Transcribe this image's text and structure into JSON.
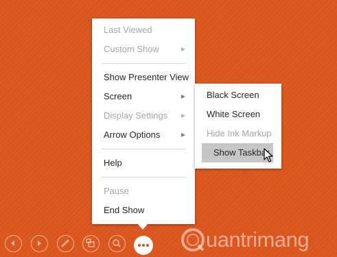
{
  "main_menu": {
    "last_viewed": "Last Viewed",
    "custom_show": "Custom Show",
    "show_presenter_view": "Show Presenter View",
    "screen": "Screen",
    "display_settings": "Display Settings",
    "arrow_options": "Arrow Options",
    "help": "Help",
    "pause": "Pause",
    "end_show": "End Show",
    "submenu_arrow": "▶"
  },
  "screen_submenu": {
    "black_screen": "Black Screen",
    "white_screen": "White Screen",
    "hide_ink_markup": "Hide Ink Markup",
    "show_taskbar": "Show Taskbar"
  },
  "toolbar": {
    "icons": [
      "previous-icon",
      "next-icon",
      "pen-icon",
      "slides-icon",
      "zoom-icon",
      "more-options-icon"
    ]
  },
  "watermark": {
    "text": "uantrimang",
    "logo": "Q"
  },
  "colors": {
    "background": "#d9551c",
    "menu_bg": "#ffffff",
    "selected_bg": "#c6c6c6",
    "disabled_text": "#a6a6a6"
  }
}
